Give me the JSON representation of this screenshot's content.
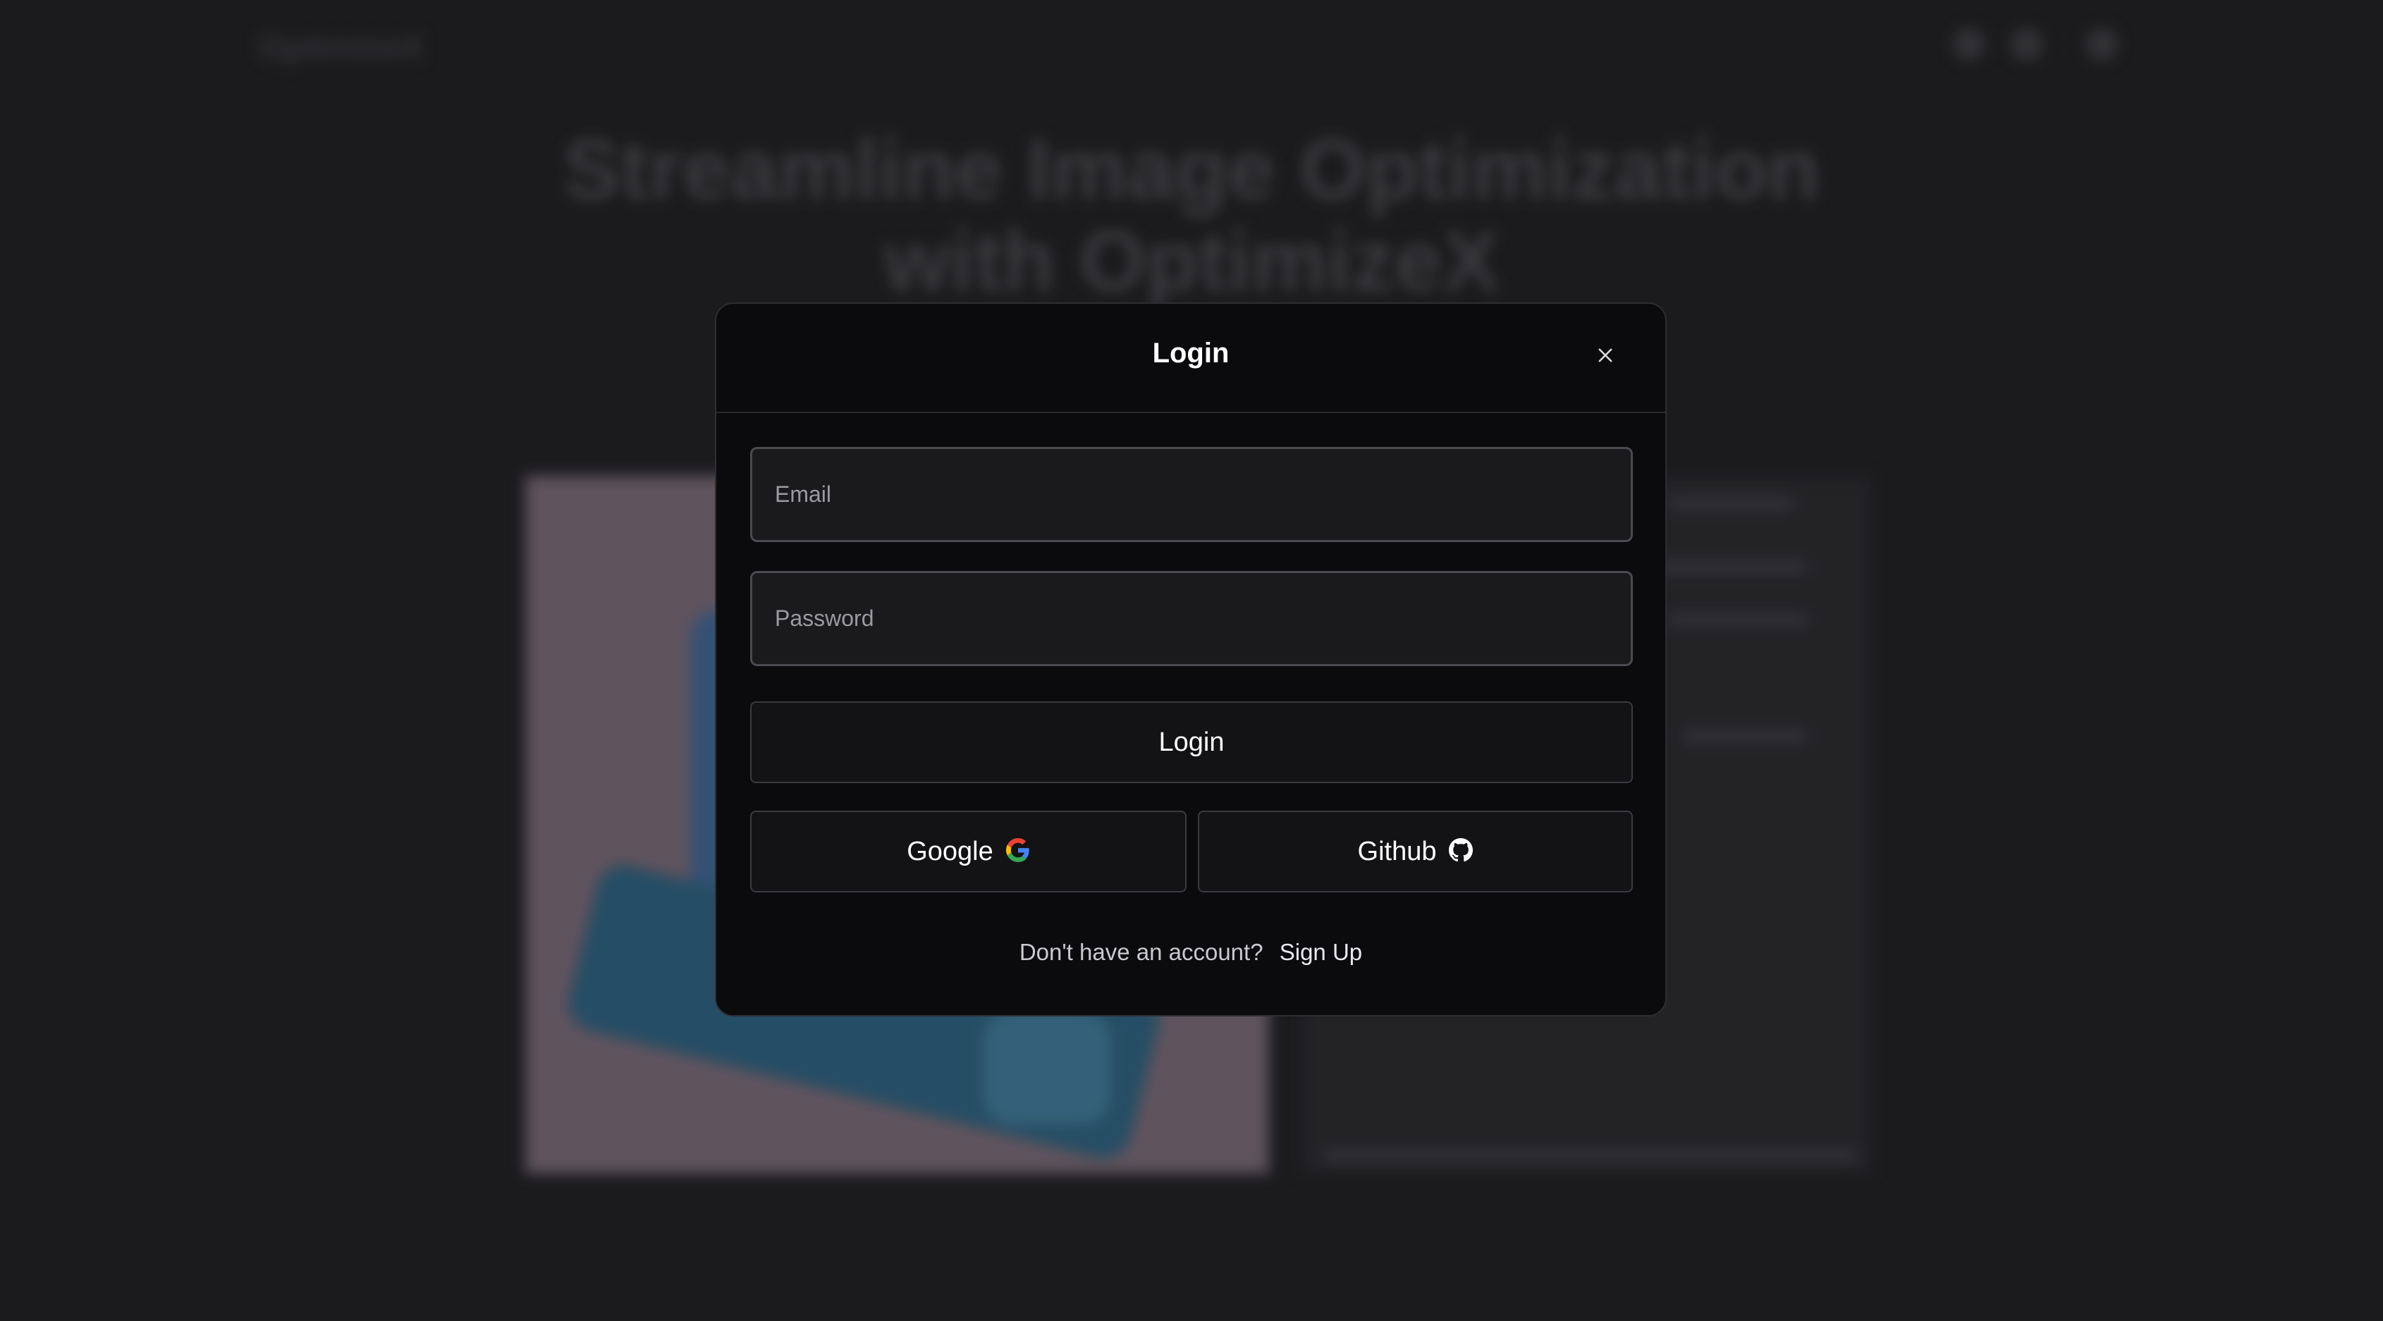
{
  "background": {
    "logo": "OptimizeX",
    "hero_title": "Streamline Image Optimization with OptimizeX",
    "hero_subtitle": "",
    "footer_left": [
      "",
      ""
    ],
    "footer_right": ""
  },
  "modal": {
    "title": "Login",
    "close_icon": "close-icon",
    "email": {
      "placeholder": "Email",
      "value": ""
    },
    "password": {
      "placeholder": "Password",
      "value": ""
    },
    "login_button": "Login",
    "google_button": "Google",
    "github_button": "Github",
    "signup_prompt": "Don't have an account?",
    "signup_link": "Sign Up"
  },
  "colors": {
    "page_background": "#1f1f22",
    "modal_background": "#0b0b0d",
    "input_background": "#1a1a1d",
    "google_blue": "#4285F4",
    "google_red": "#EA4335",
    "google_yellow": "#FBBC05",
    "google_green": "#34A853"
  }
}
